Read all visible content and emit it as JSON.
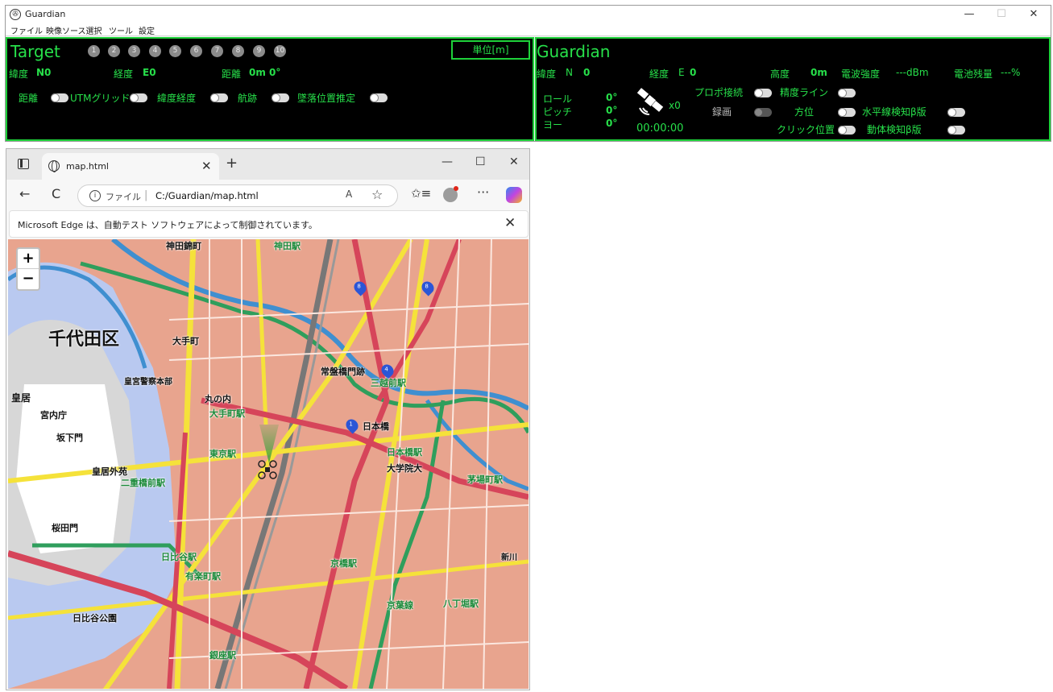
{
  "app": {
    "title": "Guardian",
    "min": "—",
    "max": "☐",
    "close": "✕",
    "menu": [
      "ファイル",
      "映像ソース選択",
      "ツール",
      "設定"
    ]
  },
  "target": {
    "title": "Target",
    "ids": [
      "1",
      "2",
      "3",
      "4",
      "5",
      "6",
      "7",
      "8",
      "9",
      "10"
    ],
    "unit_button": "単位[m]",
    "lat_label": "緯度",
    "lat_value": "N0",
    "lon_label": "経度",
    "lon_value": "E0",
    "dist_label": "距離",
    "dist_value": "0m",
    "dist_deg": "0°",
    "toggles": [
      "距離",
      "UTMグリッド",
      "緯度経度",
      "航跡",
      "墜落位置推定"
    ]
  },
  "guardian": {
    "title": "Guardian",
    "lat_label": "緯度",
    "lat_n": "N",
    "lat_value": "0",
    "lon_label": "経度",
    "lon_e": "E",
    "lon_value": "0",
    "alt_label": "高度",
    "alt_value": "0m",
    "signal_label": "電波強度",
    "signal_value": "---dBm",
    "battery_label": "電池残量",
    "battery_value": "---%",
    "roll_label": "ロール",
    "roll_value": "0°",
    "pitch_label": "ピッチ",
    "pitch_value": "0°",
    "yaw_label": "ヨー",
    "yaw_value": "0°",
    "sat_count": "x0",
    "timer": "00:00:00",
    "propo": "プロポ接続",
    "record": "録画",
    "accuracy_line": "精度ライン",
    "heading": "方位",
    "click_pos": "クリック位置",
    "horizon": "水平線検知β版",
    "motion": "動体検知β版"
  },
  "browser": {
    "tab_title": "map.html",
    "tab_close": "✕",
    "new_tab": "+",
    "min": "—",
    "max": "☐",
    "close": "✕",
    "back": "←",
    "reload": "C",
    "file_label": "ファイル",
    "sep": "|",
    "url": "C:/Guardian/map.html",
    "read_aloud": "A",
    "more": "···",
    "infobar": "Microsoft Edge は、自動テスト ソフトウェアによって制御されています。",
    "infobar_close": "✕"
  },
  "map": {
    "zoom_in": "+",
    "zoom_out": "−",
    "pins": [
      "8",
      "8",
      "4",
      "1"
    ],
    "labels": {
      "ward": "千代田区",
      "kanda": "神田駅",
      "mitoshiro": "神田錦町",
      "otemachi": "大手町",
      "otemachi_sta": "大手町駅",
      "marunouchi": "丸の内",
      "tokyo_sta": "東京駅",
      "nihonbashi": "日本橋",
      "nihonbashi_sta": "日本橋駅",
      "mitsukoshi": "三越前駅",
      "tokiwa": "常盤橋門跡",
      "kokyo": "皇居",
      "kunaicho": "宮内庁",
      "sakashita": "坂下門",
      "kokyogaien": "皇居外苑",
      "nijubashi": "二重橋前駅",
      "sakurada": "桜田門",
      "hibiya": "日比谷駅",
      "yurakucho": "有楽町駅",
      "kyobashi": "京橋駅",
      "kayabacho": "茅場町駅",
      "hatchobori": "八丁堀駅",
      "ginza": "銀座駅",
      "hibiyakoen": "日比谷公園",
      "daigakuin": "大学院大",
      "keiyo": "京葉線",
      "kokyo_police": "皇宮警察本部",
      "shinkawa": "新川"
    }
  }
}
